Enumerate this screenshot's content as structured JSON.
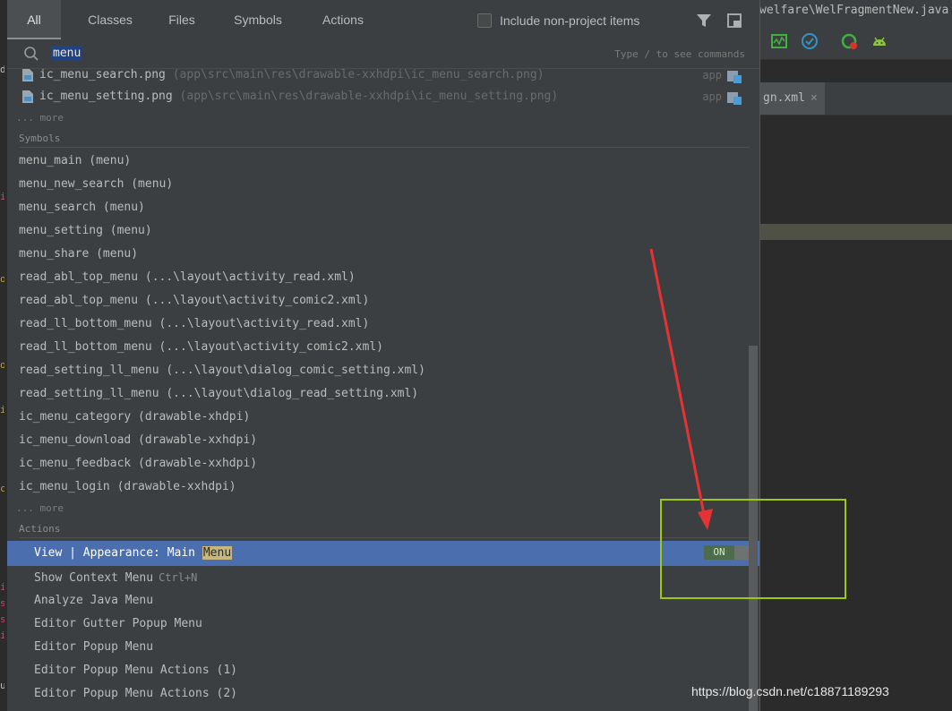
{
  "ide": {
    "title_path": "welfare\\WelFragmentNew.java",
    "editor_tab_label": "gn.xml",
    "editor_tab_close": "×"
  },
  "popup": {
    "tabs": [
      {
        "label": "All",
        "active": true
      },
      {
        "label": "Classes",
        "active": false
      },
      {
        "label": "Files",
        "active": false
      },
      {
        "label": "Symbols",
        "active": false
      },
      {
        "label": "Actions",
        "active": false
      }
    ],
    "include_label": "Include non-project items",
    "include_checked": false,
    "search": {
      "value": "menu",
      "hint": "Type / to see commands"
    },
    "files": [
      {
        "name": "ic_menu_search.png",
        "path": "(app\\src\\main\\res\\drawable-xxhdpi\\ic_menu_search.png)",
        "module": "app"
      },
      {
        "name": "ic_menu_setting.png",
        "path": "(app\\src\\main\\res\\drawable-xxhdpi\\ic_menu_setting.png)",
        "module": "app"
      }
    ],
    "files_more": "... more",
    "symbols_header": "Symbols",
    "symbols": [
      "menu_main (menu)",
      "menu_new_search (menu)",
      "menu_search (menu)",
      "menu_setting (menu)",
      "menu_share (menu)",
      "read_abl_top_menu (...\\layout\\activity_read.xml)",
      "read_abl_top_menu (...\\layout\\activity_comic2.xml)",
      "read_ll_bottom_menu (...\\layout\\activity_read.xml)",
      "read_ll_bottom_menu (...\\layout\\activity_comic2.xml)",
      "read_setting_ll_menu (...\\layout\\dialog_comic_setting.xml)",
      "read_setting_ll_menu (...\\layout\\dialog_read_setting.xml)",
      "ic_menu_category (drawable-xhdpi)",
      "ic_menu_download (drawable-xxhdpi)",
      "ic_menu_feedback (drawable-xxhdpi)",
      "ic_menu_login (drawable-xxhdpi)"
    ],
    "symbols_more": "... more",
    "actions_header": "Actions",
    "selected_action": {
      "prefix": "View | Appearance: Main ",
      "match": "Menu",
      "toggle": "ON"
    },
    "actions": [
      {
        "label": "Show Context Menu",
        "shortcut": "Ctrl+N"
      },
      {
        "label": "Analyze Java Menu",
        "shortcut": ""
      },
      {
        "label": "Editor Gutter Popup Menu",
        "shortcut": ""
      },
      {
        "label": "Editor Popup Menu",
        "shortcut": ""
      },
      {
        "label": "Editor Popup Menu Actions (1)",
        "shortcut": ""
      },
      {
        "label": "Editor Popup Menu Actions (2)",
        "shortcut": ""
      }
    ]
  },
  "watermark": "https://blog.csdn.net/c18871189293",
  "colors": {
    "popup_bg": "#3c3f41",
    "selection": "#4b6eaf",
    "annotation_box": "#9cc90f",
    "annotation_arrow": "#e53333"
  }
}
